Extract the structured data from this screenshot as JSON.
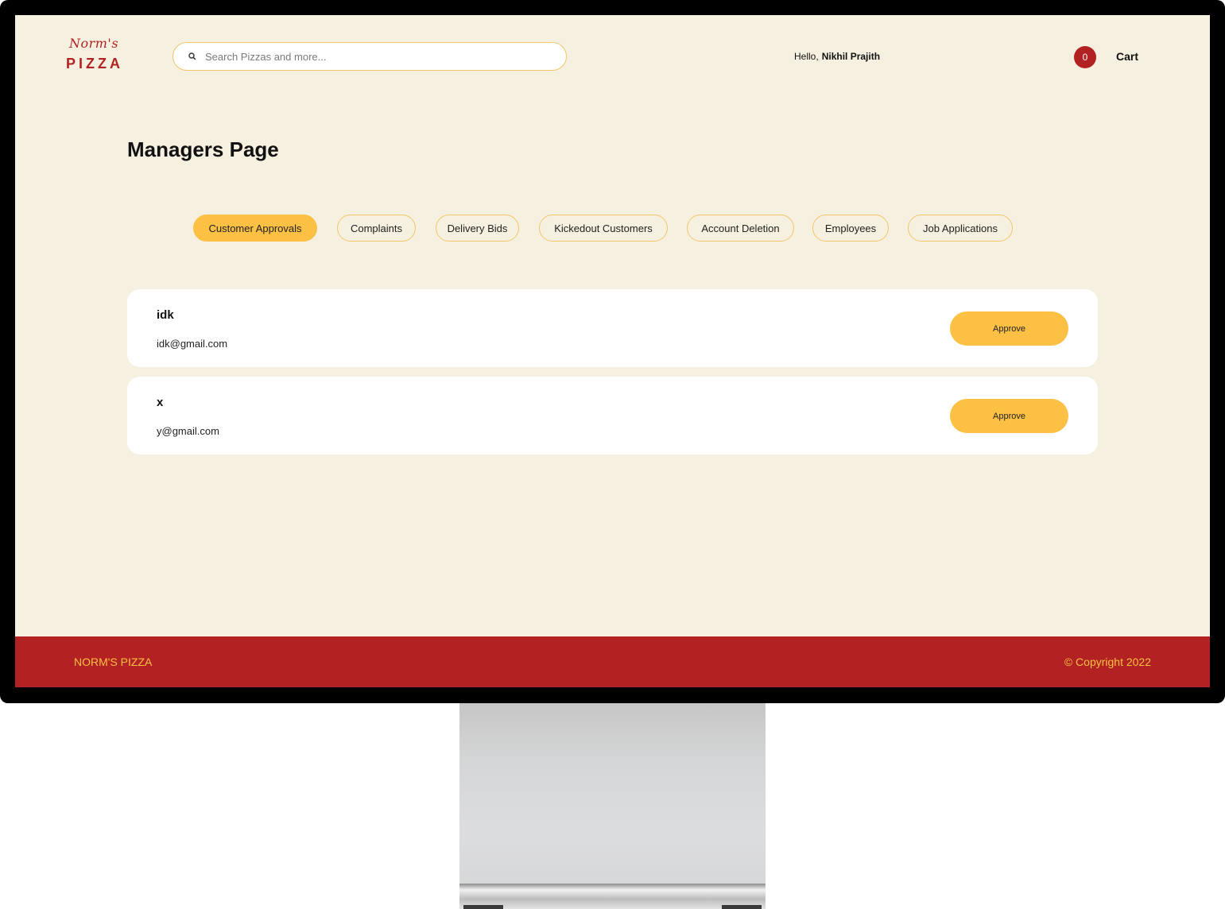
{
  "header": {
    "logo_script": "Norm's",
    "logo_main": "PIZZA",
    "search_placeholder": "Search Pizzas and more...",
    "greeting": "Hello,",
    "user_name": "Nikhil Prajith",
    "cart_count": "0",
    "cart_label": "Cart"
  },
  "page": {
    "title": "Managers Page"
  },
  "tabs": [
    {
      "label": "Customer Approvals",
      "active": true
    },
    {
      "label": "Complaints",
      "active": false
    },
    {
      "label": "Delivery Bids",
      "active": false
    },
    {
      "label": "Kickedout Customers",
      "active": false
    },
    {
      "label": "Account Deletion",
      "active": false
    },
    {
      "label": "Employees",
      "active": false
    },
    {
      "label": "Job Applications",
      "active": false
    }
  ],
  "approvals": [
    {
      "name": "idk",
      "email": "idk@gmail.com",
      "action": "Approve"
    },
    {
      "name": "x",
      "email": "y@gmail.com",
      "action": "Approve"
    }
  ],
  "footer": {
    "brand": "NORM'S PIZZA",
    "copyright": "© Copyright 2022"
  },
  "colors": {
    "brand_red": "#b22222",
    "accent_yellow": "#fbc044",
    "background": "#f5f0df"
  }
}
